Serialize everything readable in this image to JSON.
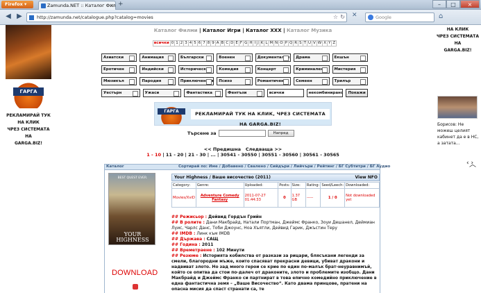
{
  "browser": {
    "app_button": "Firefox",
    "tab_title": "Zamunda.NET :: Каталог Филми",
    "url": "http://zamunda.net/catalogue.php?catalog=movies",
    "search_placeholder": "Google"
  },
  "catnav": {
    "films": "Каталог Филми",
    "games": "Каталог Игри",
    "xxx": "Каталог XXX",
    "music": "Каталог Музика",
    "sep": "|"
  },
  "alphabet": [
    "всички",
    "0",
    "1",
    "2",
    "3",
    "4",
    "5",
    "6",
    "7",
    "8",
    "9",
    "A",
    "B",
    "C",
    "D",
    "E",
    "F",
    "G",
    "H",
    "I",
    "J",
    "K",
    "L",
    "M",
    "N",
    "O",
    "P",
    "Q",
    "R",
    "S",
    "T",
    "U",
    "V",
    "W",
    "X",
    "Y",
    "Z"
  ],
  "genres": [
    [
      "Азиатски",
      "Анимация",
      "Български",
      "Военен",
      "Документален",
      "Драма",
      "Екшън"
    ],
    [
      "Еротичен",
      "Индийски",
      "Исторически",
      "Комедия",
      "Концерт",
      "Криминален",
      "Мистерия"
    ],
    [
      "Мюзикъл",
      "Пародия",
      "Приключенски",
      "Психо",
      "Романтичен",
      "Семеен",
      "Трилър"
    ],
    [
      "Уестърн",
      "Ужаси",
      "Фантастика",
      "Фентъзи"
    ]
  ],
  "filters": {
    "select1": "всички",
    "select2": "некомбинирано",
    "show_button": "Покажи"
  },
  "left_ad": {
    "logo": "ГАРГА",
    "line1": "РЕКЛАМИРАЙ ТУК",
    "line2": "НА КЛИК",
    "line3": "ЧРЕЗ СИСТЕМАТА НА",
    "line4": "GARGA.BIZ!"
  },
  "right_ad": {
    "line1": "НА КЛИК",
    "line2": "ЧРЕЗ СИСТЕМАТА НА",
    "line3": "GARGA.BIZ!"
  },
  "banner": {
    "logo": "ГАРГА",
    "text": "РЕКЛАМИРАЙ ТУК НА КЛИК, ЧРЕЗ СИСТЕМАТА НА GARGA.BIZ!"
  },
  "news": {
    "text": "Борисов: Не можеш целият кабинет да е в НС, а затата..."
  },
  "search": {
    "label": "Търсене за",
    "button": "Напред"
  },
  "pager": {
    "prev": "<< Предишна",
    "next": "Следваща >>",
    "current": "1 - 10",
    "pages": "| 11 - 20 | 21 - 30 | ... | 30541 - 30550 | 30551 - 30560 | 30561 - 30565"
  },
  "list_header": {
    "catalog": "Каталог",
    "sort": "Сортирай по: Име / Добавено / Свалено / Сийдъри / Лийчъри / Рейтинг / БГ Субтитри / БГ Аудио"
  },
  "torrent": {
    "title": "Your Highness / Ваше височество (2011)",
    "nfo": "View NFO",
    "poster_top": "BEST QUEST EVER.",
    "poster_title": "YOUR HIGHNESS",
    "headers": [
      "Category:",
      "Genre:",
      "Uploaded:",
      "Posts:",
      "Size:",
      "Rating:",
      "Seed/Leech:",
      "Downloaded:"
    ],
    "category": "Movies/XviD",
    "genre": "Adventure Comedy Fantasy",
    "uploaded": "2011-07-27 01:44:33",
    "posts": "0",
    "size": "1.37 GB",
    "rating": "-----",
    "seedleech": "1 / 0",
    "downloaded": "Not downloaded yet",
    "download": "DOWNLOAD"
  },
  "description": {
    "director_label": "## Режисьор :",
    "director": "Дейвид Гордън Грийн",
    "cast_label": "## В ролите :",
    "cast": "Дани Макбрайд, Натали Портман, Джеймс Франко, Зоуи Дешанел, Деймиан Луис, Чарлс Данс, Тоби Джоунс, Ноа Хъятли, Дейвид Гарик, Джъстин Теру",
    "imdb_label": "## IMDB :",
    "imdb": "Линк към IMDB",
    "country_label": "## Държава :",
    "country": "САЩ",
    "year_label": "## Година :",
    "year": "2011",
    "runtime_label": "## Времетраене :",
    "runtime": "102 Минути",
    "summary_label": "## Резюме :",
    "summary": "Историята кобилства от разкази за рицари, блясъкани легенди за смели, благородни мъже, които спасяват прекрасни девици, убиват дракони и надвиват злото. Но зад много герои се крие по един по-малък брат-неуравнимъй, който се опитва да стои по-далеч от драконите, злото и проблемите изобщо. Дани Макбрайд и Джеймс Франко си партнират в това епично комедийно приключение в една фантастична земя – „Ваше Височество“. Като двама принцове, пратени на опасна мисия да спаст странати са, те"
  }
}
